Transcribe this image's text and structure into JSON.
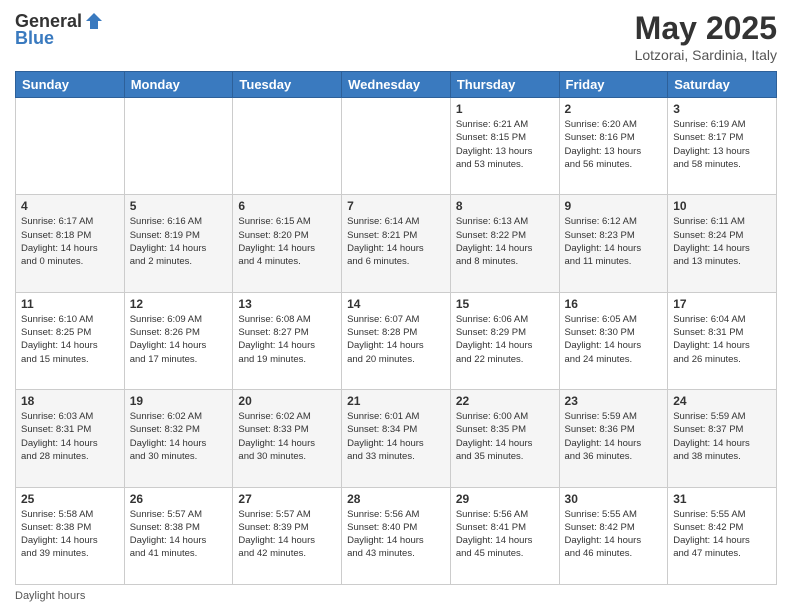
{
  "header": {
    "logo_general": "General",
    "logo_blue": "Blue",
    "title": "May 2025",
    "location": "Lotzorai, Sardinia, Italy"
  },
  "weekdays": [
    "Sunday",
    "Monday",
    "Tuesday",
    "Wednesday",
    "Thursday",
    "Friday",
    "Saturday"
  ],
  "weeks": [
    [
      {
        "day": "",
        "info": ""
      },
      {
        "day": "",
        "info": ""
      },
      {
        "day": "",
        "info": ""
      },
      {
        "day": "",
        "info": ""
      },
      {
        "day": "1",
        "info": "Sunrise: 6:21 AM\nSunset: 8:15 PM\nDaylight: 13 hours\nand 53 minutes."
      },
      {
        "day": "2",
        "info": "Sunrise: 6:20 AM\nSunset: 8:16 PM\nDaylight: 13 hours\nand 56 minutes."
      },
      {
        "day": "3",
        "info": "Sunrise: 6:19 AM\nSunset: 8:17 PM\nDaylight: 13 hours\nand 58 minutes."
      }
    ],
    [
      {
        "day": "4",
        "info": "Sunrise: 6:17 AM\nSunset: 8:18 PM\nDaylight: 14 hours\nand 0 minutes."
      },
      {
        "day": "5",
        "info": "Sunrise: 6:16 AM\nSunset: 8:19 PM\nDaylight: 14 hours\nand 2 minutes."
      },
      {
        "day": "6",
        "info": "Sunrise: 6:15 AM\nSunset: 8:20 PM\nDaylight: 14 hours\nand 4 minutes."
      },
      {
        "day": "7",
        "info": "Sunrise: 6:14 AM\nSunset: 8:21 PM\nDaylight: 14 hours\nand 6 minutes."
      },
      {
        "day": "8",
        "info": "Sunrise: 6:13 AM\nSunset: 8:22 PM\nDaylight: 14 hours\nand 8 minutes."
      },
      {
        "day": "9",
        "info": "Sunrise: 6:12 AM\nSunset: 8:23 PM\nDaylight: 14 hours\nand 11 minutes."
      },
      {
        "day": "10",
        "info": "Sunrise: 6:11 AM\nSunset: 8:24 PM\nDaylight: 14 hours\nand 13 minutes."
      }
    ],
    [
      {
        "day": "11",
        "info": "Sunrise: 6:10 AM\nSunset: 8:25 PM\nDaylight: 14 hours\nand 15 minutes."
      },
      {
        "day": "12",
        "info": "Sunrise: 6:09 AM\nSunset: 8:26 PM\nDaylight: 14 hours\nand 17 minutes."
      },
      {
        "day": "13",
        "info": "Sunrise: 6:08 AM\nSunset: 8:27 PM\nDaylight: 14 hours\nand 19 minutes."
      },
      {
        "day": "14",
        "info": "Sunrise: 6:07 AM\nSunset: 8:28 PM\nDaylight: 14 hours\nand 20 minutes."
      },
      {
        "day": "15",
        "info": "Sunrise: 6:06 AM\nSunset: 8:29 PM\nDaylight: 14 hours\nand 22 minutes."
      },
      {
        "day": "16",
        "info": "Sunrise: 6:05 AM\nSunset: 8:30 PM\nDaylight: 14 hours\nand 24 minutes."
      },
      {
        "day": "17",
        "info": "Sunrise: 6:04 AM\nSunset: 8:31 PM\nDaylight: 14 hours\nand 26 minutes."
      }
    ],
    [
      {
        "day": "18",
        "info": "Sunrise: 6:03 AM\nSunset: 8:31 PM\nDaylight: 14 hours\nand 28 minutes."
      },
      {
        "day": "19",
        "info": "Sunrise: 6:02 AM\nSunset: 8:32 PM\nDaylight: 14 hours\nand 30 minutes."
      },
      {
        "day": "20",
        "info": "Sunrise: 6:02 AM\nSunset: 8:33 PM\nDaylight: 14 hours\nand 30 minutes."
      },
      {
        "day": "21",
        "info": "Sunrise: 6:01 AM\nSunset: 8:34 PM\nDaylight: 14 hours\nand 33 minutes."
      },
      {
        "day": "22",
        "info": "Sunrise: 6:00 AM\nSunset: 8:35 PM\nDaylight: 14 hours\nand 35 minutes."
      },
      {
        "day": "23",
        "info": "Sunrise: 5:59 AM\nSunset: 8:36 PM\nDaylight: 14 hours\nand 36 minutes."
      },
      {
        "day": "24",
        "info": "Sunrise: 5:59 AM\nSunset: 8:37 PM\nDaylight: 14 hours\nand 38 minutes."
      }
    ],
    [
      {
        "day": "25",
        "info": "Sunrise: 5:58 AM\nSunset: 8:38 PM\nDaylight: 14 hours\nand 39 minutes."
      },
      {
        "day": "26",
        "info": "Sunrise: 5:57 AM\nSunset: 8:38 PM\nDaylight: 14 hours\nand 41 minutes."
      },
      {
        "day": "27",
        "info": "Sunrise: 5:57 AM\nSunset: 8:39 PM\nDaylight: 14 hours\nand 42 minutes."
      },
      {
        "day": "28",
        "info": "Sunrise: 5:56 AM\nSunset: 8:40 PM\nDaylight: 14 hours\nand 43 minutes."
      },
      {
        "day": "29",
        "info": "Sunrise: 5:56 AM\nSunset: 8:41 PM\nDaylight: 14 hours\nand 45 minutes."
      },
      {
        "day": "30",
        "info": "Sunrise: 5:55 AM\nSunset: 8:42 PM\nDaylight: 14 hours\nand 46 minutes."
      },
      {
        "day": "31",
        "info": "Sunrise: 5:55 AM\nSunset: 8:42 PM\nDaylight: 14 hours\nand 47 minutes."
      }
    ]
  ],
  "footer": {
    "daylight_label": "Daylight hours"
  }
}
